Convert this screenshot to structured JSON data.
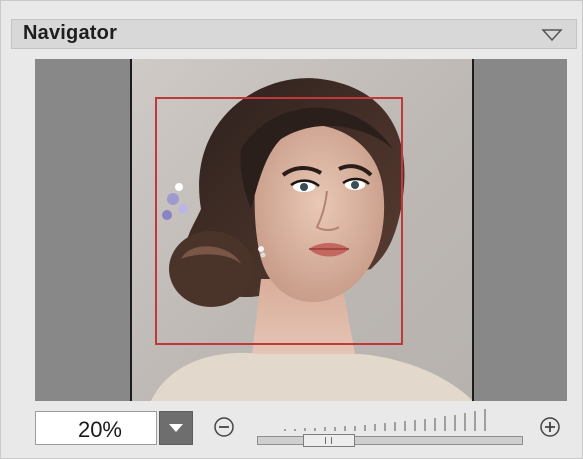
{
  "panel": {
    "title": "Navigator"
  },
  "icons": {
    "collapse": "triangle-down-icon",
    "dropdown": "caret-down-icon",
    "zoom_out": "circle-minus-icon",
    "zoom_in": "circle-plus-icon"
  },
  "zoom": {
    "value": "20%",
    "slider_fraction": 0.2
  },
  "colors": {
    "panel_bg": "#e9e9e9",
    "header_bg": "#d8d8d8",
    "viewport_bg": "#888888",
    "visible_area_frame": "#c0383a",
    "dropdown_bg": "#6e6e6e"
  }
}
